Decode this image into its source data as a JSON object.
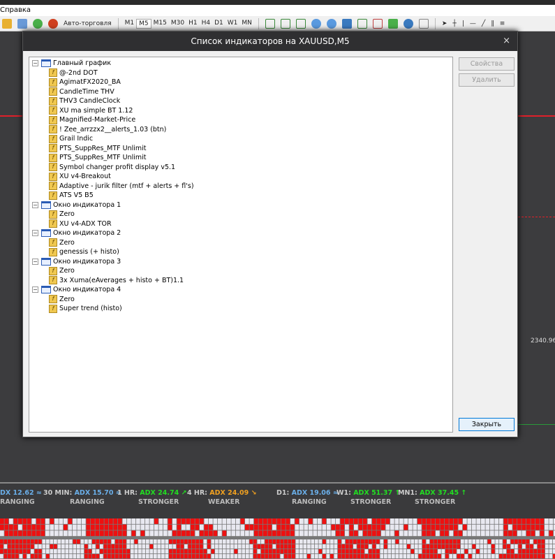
{
  "menu": {
    "help": "Справка"
  },
  "toolbar": {
    "autotrade": "Авто-торговля",
    "timeframes": [
      "M1",
      "M5",
      "M15",
      "M30",
      "H1",
      "H4",
      "D1",
      "W1",
      "MN"
    ],
    "selected": "M5"
  },
  "chart": {
    "price_label": "2340.96",
    "colors": {
      "line": "#e0202a",
      "bg": "#3c3c3e"
    }
  },
  "dialog": {
    "title": "Список индикаторов на XAUUSD,M5",
    "close": "×",
    "buttons": {
      "properties": "Свойства",
      "delete": "Удалить",
      "close": "Закрыть"
    },
    "tree": [
      {
        "label": "Главный график",
        "children": [
          "@-2nd DOT",
          "AgimatFX2020_BA",
          "CandleTime THV",
          "THV3 CandleClock",
          "XU ma simple BT 1.12",
          "Magnified-Market-Price",
          "! Zee_arrzzx2__alerts_1.03 (btn)",
          "Grail Indic",
          "PTS_SuppRes_MTF Unlimit",
          "PTS_SuppRes_MTF Unlimit",
          "Symbol changer profit display v5.1",
          "XU v4-Breakout",
          "Adaptive -  jurik filter (mtf + alerts + fl's)",
          "ATS V5 B5"
        ]
      },
      {
        "label": "Окно индикатора 1",
        "children": [
          "Zero",
          "XU v4-ADX TOR"
        ]
      },
      {
        "label": "Окно индикатора 2",
        "children": [
          "Zero",
          "genessis (+ histo)"
        ]
      },
      {
        "label": "Окно индикатора 3",
        "children": [
          "Zero",
          "3x Xuma(eAverages + histo + BT)1.1"
        ]
      },
      {
        "label": "Окно индикатора 4",
        "children": [
          "Zero",
          "Super trend (histo)"
        ]
      }
    ]
  },
  "adx": [
    {
      "tf": "",
      "value": "DX 12.62 ≈",
      "state": "RANGING",
      "color": "#6aaee8"
    },
    {
      "tf": "30 MIN:",
      "value": "ADX 15.70 ≈",
      "state": "RANGING",
      "color": "#6aaee8"
    },
    {
      "tf": "1 HR:",
      "value": "ADX 24.74 ↗",
      "state": "STRONGER",
      "color": "#22dd22"
    },
    {
      "tf": "4 HR:",
      "value": "ADX 24.09 ↘",
      "state": "WEAKER",
      "color": "#f0a020"
    },
    {
      "tf": "D1:",
      "value": "ADX 19.06 ≈",
      "state": "RANGING",
      "color": "#6aaee8"
    },
    {
      "tf": "W1:",
      "value": "ADX 51.37 ↑",
      "state": "STRONGER",
      "color": "#22dd22"
    },
    {
      "tf": "MN1:",
      "value": "ADX 37.45 ↑",
      "state": "STRONGER",
      "color": "#22dd22"
    }
  ]
}
